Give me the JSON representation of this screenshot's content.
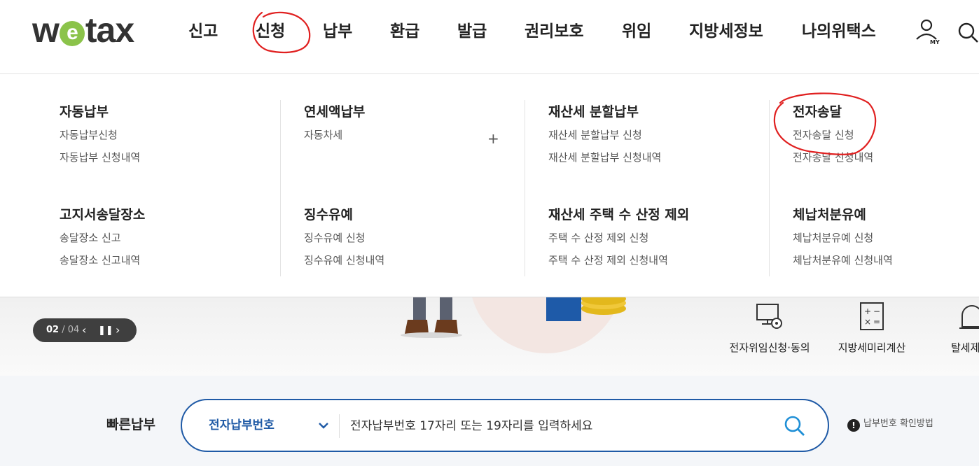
{
  "brand": {
    "logo_pre": "w",
    "logo_e": "e",
    "logo_post": "tax"
  },
  "nav": [
    "신고",
    "신청",
    "납부",
    "환급",
    "발급",
    "권리보호",
    "위임",
    "지방세정보",
    "나의위택스"
  ],
  "header_icons": {
    "my_label": "MY"
  },
  "mega_menu": {
    "col1": {
      "group1": {
        "title": "자동납부",
        "links": [
          "자동납부신청",
          "자동납부 신청내역"
        ]
      },
      "group2": {
        "title": "고지서송달장소",
        "links": [
          "송달장소 신고",
          "송달장소 신고내역"
        ]
      }
    },
    "col2": {
      "group1": {
        "title": "연세액납부",
        "links": [
          "자동차세"
        ]
      },
      "group2": {
        "title": "징수유예",
        "links": [
          "징수유예 신청",
          "징수유예 신청내역"
        ]
      }
    },
    "col3": {
      "group1": {
        "title": "재산세 분할납부",
        "links": [
          "재산세 분할납부 신청",
          "재산세 분할납부 신청내역"
        ]
      },
      "group2": {
        "title": "재산세 주택 수 산정 제외",
        "links": [
          "주택 수 산정 제외 신청",
          "주택 수 산정 제외 신청내역"
        ]
      }
    },
    "col4": {
      "group1": {
        "title": "전자송달",
        "links": [
          "전자송달 신청",
          "전자송달 신청내역"
        ]
      },
      "group2": {
        "title": "체납처분유예",
        "links": [
          "체납처분유예 신청",
          "체납처분유예 신청내역"
        ]
      }
    }
  },
  "banner_pager": {
    "current": "02",
    "sep": " / ",
    "total": "04"
  },
  "quick_menu": [
    "전자위임신청·동의",
    "지방세미리계산",
    "탈세제"
  ],
  "quick_pay": {
    "label": "빠른납부",
    "select_value": "전자납부번호",
    "placeholder": "전자납부번호 17자리 또는 19자리를 입력하세요",
    "help": "납부번호 확인방법"
  },
  "annotation_color": "#e02020"
}
